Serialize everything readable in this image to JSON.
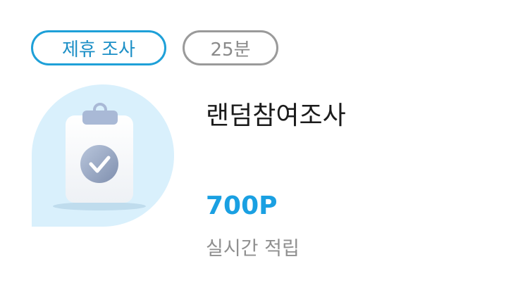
{
  "tags": {
    "partner_label": "제휴 조사",
    "duration_label": "25분"
  },
  "survey": {
    "title": "랜덤참여조사",
    "reward": "700P",
    "reward_note": "실시간 적립",
    "thumbnail_icon": "clipboard-check-icon"
  },
  "colors": {
    "accent": "#1aa0e2",
    "thumbnail_bg": "#d9f0fc",
    "muted": "#8f8f8f"
  }
}
